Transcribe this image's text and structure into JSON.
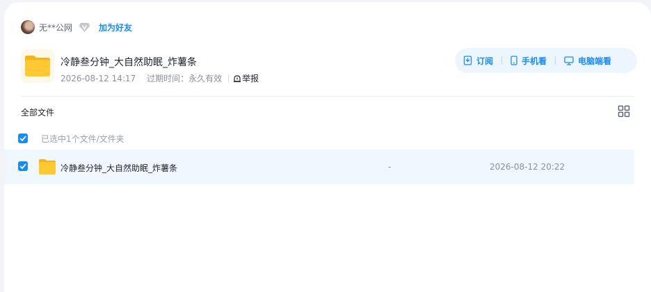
{
  "header": {
    "username": "无**公网",
    "add_friend_label": "加为好友",
    "vip_icon": "diamond-v-icon"
  },
  "share": {
    "title": "冷静叁分钟_大自然助眠_炸薯条",
    "created": "2026-08-12 14:17",
    "expiry_label": "过期时间：",
    "expiry_value": "永久有效",
    "report_label": "举报"
  },
  "actions": {
    "subscribe_label": "订阅",
    "mobile_label": "手机看",
    "desktop_label": "电脑端看"
  },
  "file_list": {
    "breadcrumb": "全部文件",
    "selection_text": "已选中1个文件/文件夹",
    "rows": [
      {
        "name": "冷静叁分钟_大自然助眠_炸薯条",
        "size": "-",
        "date": "2026-08-12 20:22",
        "selected": true
      }
    ]
  },
  "colors": {
    "accent": "#1a8cf0",
    "selected_row_bg": "#f0f7fe",
    "action_bar_bg": "#edf6fe",
    "folder_yellow": "#ffc933"
  }
}
